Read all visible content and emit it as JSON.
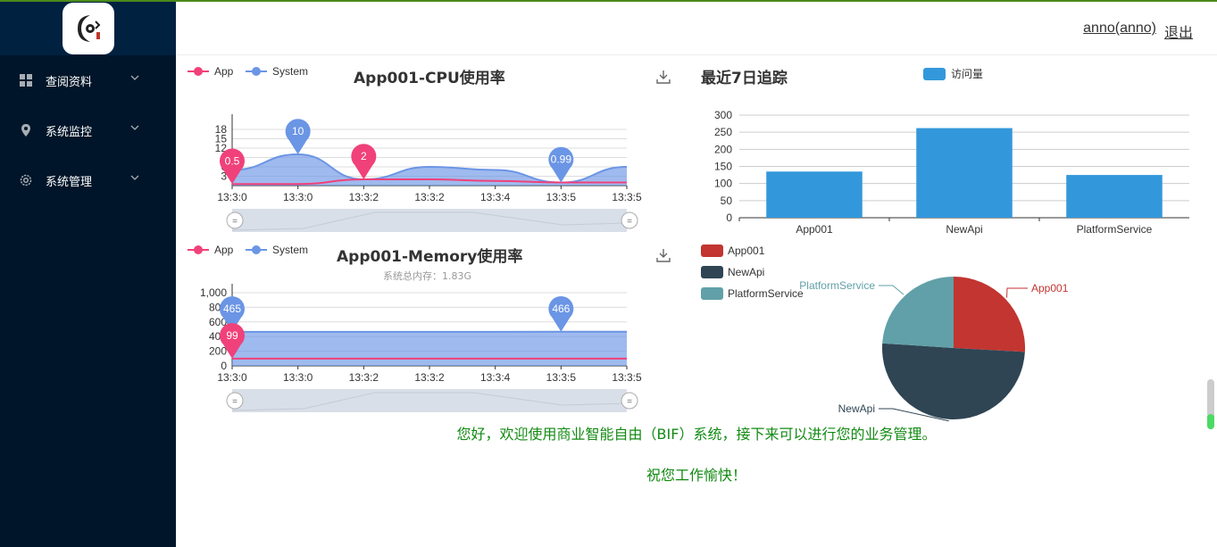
{
  "sidebar": {
    "items": [
      {
        "label": "查阅资料",
        "icon": "grid-icon"
      },
      {
        "label": "系统监控",
        "icon": "location-pin-icon"
      },
      {
        "label": "系统管理",
        "icon": "gear-icon"
      }
    ]
  },
  "header": {
    "user": "anno(anno)",
    "logout": "退出"
  },
  "cpu_chart": {
    "title": "App001-CPU使用率",
    "legend": [
      "App",
      "System"
    ],
    "colors": {
      "app": "#f0417a",
      "system": "#6b95e5"
    },
    "y_ticks": [
      "3",
      "6",
      "9",
      "12",
      "15",
      "18"
    ],
    "x_ticks": [
      "13:3:0",
      "13:3:0",
      "13:3:2",
      "13:3:2",
      "13:3:4",
      "13:3:5",
      "13:3:5"
    ],
    "markers": [
      {
        "series": "App",
        "label": "0.5"
      },
      {
        "series": "System",
        "label": "10"
      },
      {
        "series": "App",
        "label": "2"
      },
      {
        "series": "System",
        "label": "0.99"
      }
    ]
  },
  "mem_chart": {
    "title": "App001-Memory使用率",
    "subtitle": "系统总内存：1.83G",
    "legend": [
      "App",
      "System"
    ],
    "y_ticks": [
      "0",
      "200",
      "400",
      "600",
      "800",
      "1,000"
    ],
    "x_ticks": [
      "13:3:0",
      "13:3:0",
      "13:3:2",
      "13:3:2",
      "13:3:4",
      "13:3:5",
      "13:3:5"
    ],
    "markers": [
      {
        "series": "System",
        "label": "465"
      },
      {
        "series": "App",
        "label": "99"
      },
      {
        "series": "System",
        "label": "466"
      }
    ]
  },
  "chart_data": [
    {
      "type": "area",
      "title": "App001-CPU使用率",
      "x": [
        "13:3:0",
        "13:3:0",
        "13:3:2",
        "13:3:2",
        "13:3:4",
        "13:3:5",
        "13:3:5"
      ],
      "ylim": [
        0,
        20
      ],
      "series": [
        {
          "name": "App",
          "values": [
            0.5,
            0.5,
            2,
            2,
            1.5,
            1,
            1
          ]
        },
        {
          "name": "System",
          "values": [
            5,
            10,
            2,
            6,
            5,
            0.99,
            6
          ]
        }
      ]
    },
    {
      "type": "area",
      "title": "App001-Memory使用率",
      "x": [
        "13:3:0",
        "13:3:0",
        "13:3:2",
        "13:3:2",
        "13:3:4",
        "13:3:5",
        "13:3:5"
      ],
      "ylim": [
        0,
        1000
      ],
      "series": [
        {
          "name": "App",
          "values": [
            99,
            99,
            99,
            99,
            99,
            99,
            99
          ]
        },
        {
          "name": "System",
          "values": [
            465,
            465,
            465,
            465,
            465,
            466,
            466
          ]
        }
      ]
    },
    {
      "type": "bar",
      "title": "最近7日追踪",
      "categories": [
        "App001",
        "NewApi",
        "PlatformService"
      ],
      "series": [
        {
          "name": "访问量",
          "values": [
            135,
            262,
            125
          ]
        }
      ],
      "ylim": [
        0,
        300
      ],
      "y_ticks": [
        "0",
        "50",
        "100",
        "150",
        "200",
        "250",
        "300"
      ],
      "color": "#3398db"
    },
    {
      "type": "pie",
      "categories": [
        "App001",
        "NewApi",
        "PlatformService"
      ],
      "values": [
        135,
        262,
        125
      ],
      "colors": [
        "#c23531",
        "#2f4554",
        "#61a0a8"
      ]
    }
  ],
  "bar_chart": {
    "title": "最近7日追踪",
    "legend": "访问量"
  },
  "pie_chart": {
    "legend": [
      "App001",
      "NewApi",
      "PlatformService"
    ]
  },
  "welcome": {
    "line1": "您好，欢迎使用商业智能自由（BIF）系统，接下来可以进行您的业务管理。",
    "line2": "祝您工作愉快！"
  }
}
